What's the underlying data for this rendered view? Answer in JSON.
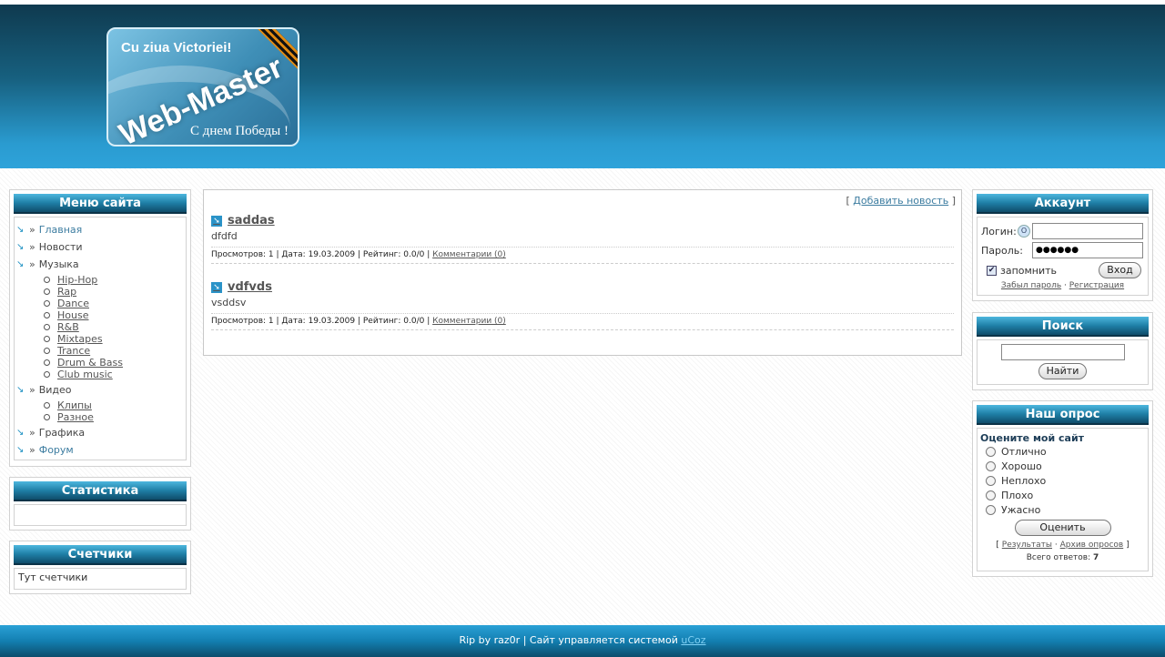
{
  "logo": {
    "top_text": "Cu ziua Victoriei!",
    "main_text": "Web-Master",
    "bottom_text": "С днем Победы !"
  },
  "menu": {
    "title": "Меню сайта",
    "items": [
      {
        "label": "Главная",
        "sub": []
      },
      {
        "label": "Новости",
        "sub": []
      },
      {
        "label": "Музыка",
        "sub": [
          "Hip-Hop",
          "Rap",
          "Dance",
          "House",
          "R&B",
          "Mixtapes",
          "Trance",
          "Drum & Bass",
          "Club music"
        ]
      },
      {
        "label": "Видео",
        "sub": [
          "Клипы",
          "Разное"
        ]
      },
      {
        "label": "Графика",
        "sub": []
      },
      {
        "label": "Форум",
        "sub": []
      }
    ]
  },
  "stats": {
    "title": "Статистика"
  },
  "counters": {
    "title": "Счетчики",
    "text": "Тут счетчики"
  },
  "news": {
    "add_link": "Добавить новость",
    "entries": [
      {
        "title": "saddas",
        "text": "dfdfd",
        "meta": "Просмотров: 1 | Дата: 19.03.2009 | Рейтинг: 0.0/0 |",
        "comments": "Комментарии (0)"
      },
      {
        "title": "vdfvds",
        "text": "vsddsv",
        "meta": "Просмотров: 1 | Дата: 19.03.2009 | Рейтинг: 0.0/0 |",
        "comments": "Комментарии (0)"
      }
    ]
  },
  "account": {
    "title": "Аккаунт",
    "login_label": "Логин:",
    "password_label": "Пароль:",
    "password_value": "●●●●●●",
    "remember_label": "запомнить",
    "login_button": "Вход",
    "forgot_link": "Забыл пароль",
    "separator": "·",
    "register_link": "Регистрация"
  },
  "search": {
    "title": "Поиск",
    "button": "Найти"
  },
  "poll": {
    "title": "Наш опрос",
    "question": "Оцените мой сайт",
    "options": [
      "Отлично",
      "Хорошо",
      "Неплохо",
      "Плохо",
      "Ужасно"
    ],
    "vote_button": "Оценить",
    "results_link": "Результаты",
    "archive_link": "Архив опросов",
    "total_label": "Всего ответов:",
    "total_value": "7"
  },
  "footer": {
    "text": "Rip by raz0r | Сайт управляется системой",
    "ucoz": "uCoz"
  }
}
